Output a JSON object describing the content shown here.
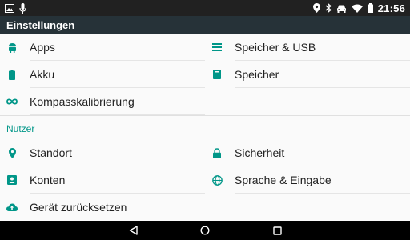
{
  "status_bar": {
    "time": "21:56",
    "left_icons": [
      "image-icon",
      "microphone-icon"
    ],
    "right_icons": [
      "location-icon",
      "bluetooth-icon",
      "car-icon",
      "wifi-icon",
      "battery-icon"
    ]
  },
  "app_bar": {
    "title": "Einstellungen"
  },
  "colors": {
    "accent": "#009688",
    "app_bar": "#263238",
    "status_bar": "#212121"
  },
  "sections": {
    "main": {
      "items": [
        {
          "label": "Apps",
          "icon": "android-icon"
        },
        {
          "label": "Speicher & USB",
          "icon": "storage-list-icon"
        },
        {
          "label": "Akku",
          "icon": "battery-icon"
        },
        {
          "label": "Speicher",
          "icon": "memory-icon"
        },
        {
          "label": "Kompasskalibrierung",
          "icon": "infinity-icon"
        }
      ]
    },
    "nutzer": {
      "title": "Nutzer",
      "items": [
        {
          "label": "Standort",
          "icon": "location-pin-icon"
        },
        {
          "label": "Sicherheit",
          "icon": "lock-icon"
        },
        {
          "label": "Konten",
          "icon": "account-box-icon"
        },
        {
          "label": "Sprache & Eingabe",
          "icon": "globe-icon"
        },
        {
          "label": "Gerät zurücksetzen",
          "icon": "cloud-upload-icon"
        }
      ]
    }
  },
  "nav_bar": {
    "buttons": [
      "back-icon",
      "home-icon",
      "recents-icon"
    ]
  }
}
